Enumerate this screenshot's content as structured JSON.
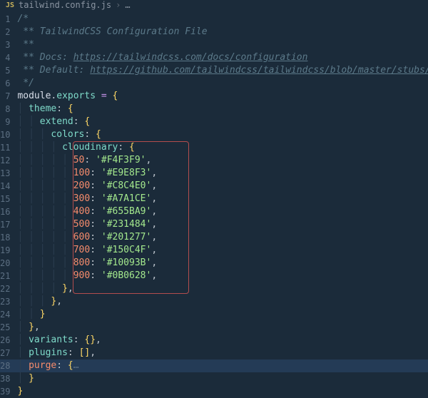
{
  "breadcrumb": {
    "icon_label": "JS",
    "filename": "tailwind.config.js",
    "sep": "›",
    "trail": "…"
  },
  "gutter": {
    "numbers": [
      "1",
      "2",
      "3",
      "4",
      "5",
      "6",
      "7",
      "8",
      "9",
      "10",
      "11",
      "12",
      "13",
      "14",
      "15",
      "16",
      "17",
      "18",
      "19",
      "20",
      "21",
      "22",
      "23",
      "24",
      "25",
      "26",
      "27",
      "28",
      "38",
      "39"
    ]
  },
  "code": {
    "c1": "/*",
    "c2_a": " ** ",
    "c2_b": "TailwindCSS Configuration File",
    "c3": " **",
    "c4_a": " ** Docs: ",
    "c4_b": "https://tailwindcss.com/docs/configuration",
    "c5_a": " ** Default: ",
    "c5_b": "https://github.com/tailwindcss/tailwindcss/blob/master/stubs/def",
    "c6": " */",
    "module": "module",
    "dot": ".",
    "exports": "exports",
    "eq": " = ",
    "lbrace": "{",
    "rbrace": "}",
    "lbracket": "[",
    "rbracket": "]",
    "colon": ": ",
    "comma": ",",
    "theme": "theme",
    "extend": "extend",
    "colors": "colors",
    "cloudinary": "cloudinary",
    "k50": "50",
    "k100": "100",
    "k200": "200",
    "k300": "300",
    "k400": "400",
    "k500": "500",
    "k600": "600",
    "k700": "700",
    "k800": "800",
    "k900": "900",
    "v50": "'#F4F3F9'",
    "v100": "'#E9E8F3'",
    "v200": "'#C8C4E0'",
    "v300": "'#A7A1CE'",
    "v400": "'#655BA9'",
    "v500": "'#231484'",
    "v600": "'#201277'",
    "v700": "'#150C4F'",
    "v800": "'#10093B'",
    "v900": "'#0B0628'",
    "variants": "variants",
    "plugins": "plugins",
    "purge": "purge",
    "fold": "…"
  }
}
